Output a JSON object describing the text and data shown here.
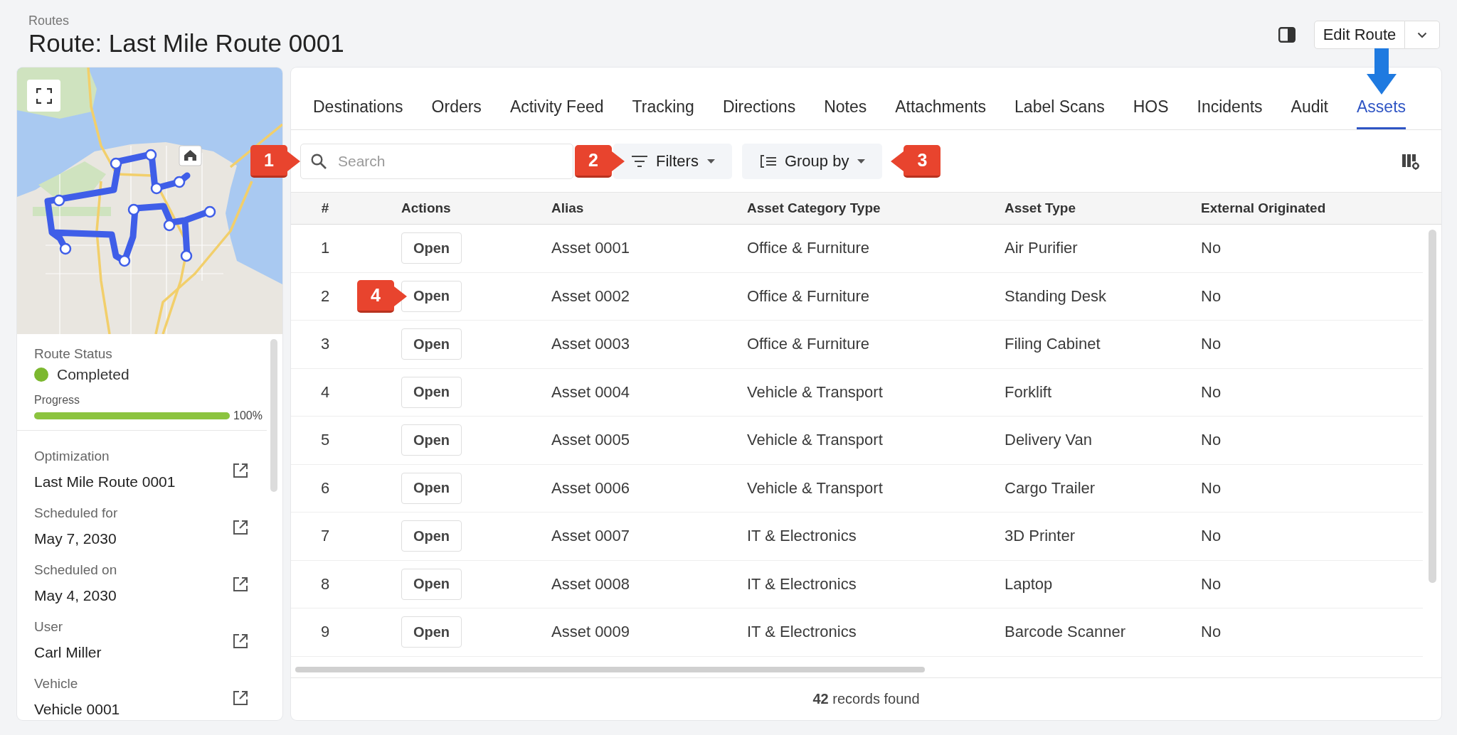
{
  "header": {
    "breadcrumb": "Routes",
    "title": "Route: Last Mile Route 0001",
    "edit_button": "Edit Route"
  },
  "route_panel": {
    "status": {
      "label": "Route Status",
      "value": "Completed",
      "color": "#7cb82f"
    },
    "progress": {
      "label": "Progress",
      "level": 1,
      "reading": "100%"
    },
    "details": [
      {
        "label": "Optimization",
        "value": "Last Mile Route 0001"
      },
      {
        "label": "Scheduled for",
        "value": "May 7, 2030"
      },
      {
        "label": "Scheduled on",
        "value": "May 4, 2030"
      },
      {
        "label": "User",
        "value": "Carl Miller"
      },
      {
        "label": "Vehicle",
        "value": "Vehicle 0001"
      }
    ]
  },
  "tabs": [
    {
      "label": "Destinations",
      "selected": false,
      "arrow": false
    },
    {
      "label": "Orders",
      "selected": false,
      "arrow": false
    },
    {
      "label": "Activity Feed",
      "selected": false,
      "arrow": false
    },
    {
      "label": "Tracking",
      "selected": false,
      "arrow": false
    },
    {
      "label": "Directions",
      "selected": false,
      "arrow": false
    },
    {
      "label": "Notes",
      "selected": false,
      "arrow": false
    },
    {
      "label": "Attachments",
      "selected": false,
      "arrow": false
    },
    {
      "label": "Label Scans",
      "selected": false,
      "arrow": false
    },
    {
      "label": "HOS",
      "selected": false,
      "arrow": false
    },
    {
      "label": "Incidents",
      "selected": false,
      "arrow": false
    },
    {
      "label": "Audit",
      "selected": false,
      "arrow": false
    },
    {
      "label": "Assets",
      "selected": true,
      "arrow": true
    }
  ],
  "toolbar": {
    "search": {
      "placeholder": "Search",
      "callout": "1"
    },
    "filters": {
      "label": "Filters",
      "callout": "2"
    },
    "group_by": {
      "label": "Group by",
      "callout": "3"
    }
  },
  "table": {
    "columns": [
      "#",
      "Actions",
      "Alias",
      "Asset Category Type",
      "Asset Type",
      "External Originated"
    ],
    "rows": [
      {
        "number": "1",
        "action": "Open",
        "alias": "Asset 0001",
        "category": "Office & Furniture",
        "asset_type": "Air Purifier",
        "external": "No"
      },
      {
        "number": "2",
        "action": "Open",
        "alias": "Asset 0002",
        "category": "Office & Furniture",
        "asset_type": "Standing Desk",
        "external": "No",
        "callout": "4"
      },
      {
        "number": "3",
        "action": "Open",
        "alias": "Asset 0003",
        "category": "Office & Furniture",
        "asset_type": "Filing Cabinet",
        "external": "No"
      },
      {
        "number": "4",
        "action": "Open",
        "alias": "Asset 0004",
        "category": "Vehicle & Transport",
        "asset_type": "Forklift",
        "external": "No"
      },
      {
        "number": "5",
        "action": "Open",
        "alias": "Asset 0005",
        "category": "Vehicle & Transport",
        "asset_type": "Delivery Van",
        "external": "No"
      },
      {
        "number": "6",
        "action": "Open",
        "alias": "Asset 0006",
        "category": "Vehicle & Transport",
        "asset_type": "Cargo Trailer",
        "external": "No"
      },
      {
        "number": "7",
        "action": "Open",
        "alias": "Asset 0007",
        "category": "IT & Electronics",
        "asset_type": "3D Printer",
        "external": "No"
      },
      {
        "number": "8",
        "action": "Open",
        "alias": "Asset 0008",
        "category": "IT & Electronics",
        "asset_type": "Laptop",
        "external": "No"
      },
      {
        "number": "9",
        "action": "Open",
        "alias": "Asset 0009",
        "category": "IT & Electronics",
        "asset_type": "Barcode Scanner",
        "external": "No"
      }
    ]
  },
  "footer": {
    "summary": "**42** records found"
  }
}
